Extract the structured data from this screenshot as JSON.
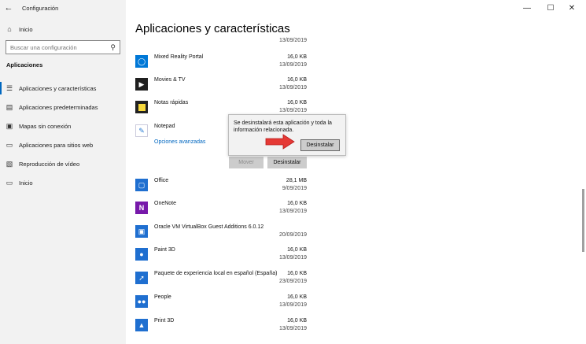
{
  "window": {
    "app_title": "Configuración",
    "back_icon": "back-arrow-icon",
    "minimize": "—",
    "maximize": "☐",
    "close": "✕"
  },
  "sidebar": {
    "home": "Inicio",
    "search_placeholder": "Buscar una configuración",
    "section": "Aplicaciones",
    "items": [
      {
        "label": "Aplicaciones y características",
        "icon": "list-icon"
      },
      {
        "label": "Aplicaciones predeterminadas",
        "icon": "default-apps-icon"
      },
      {
        "label": "Mapas sin conexión",
        "icon": "map-icon"
      },
      {
        "label": "Aplicaciones para sitios web",
        "icon": "web-apps-icon"
      },
      {
        "label": "Reproducción de vídeo",
        "icon": "video-icon"
      },
      {
        "label": "Inicio",
        "icon": "startup-icon"
      }
    ]
  },
  "main": {
    "title": "Aplicaciones y características",
    "top_date": "13/09/2019",
    "apps": [
      {
        "name": "Mixed Reality Portal",
        "size": "16,0 KB",
        "date": "13/09/2019",
        "color": "#0078d7",
        "icon": "mixed-reality-icon"
      },
      {
        "name": "Movies & TV",
        "size": "16,0 KB",
        "date": "13/09/2019",
        "color": "#1f1f1f",
        "icon": "movies-icon"
      },
      {
        "name": "Notas rápidas",
        "size": "16,0 KB",
        "date": "13/09/2019",
        "color": "#222222",
        "icon": "sticky-notes-icon"
      },
      {
        "name": "Notepad",
        "size": "",
        "date": "",
        "color": "#ffffff",
        "icon": "notepad-icon"
      },
      {
        "name": "Office",
        "size": "28,1 MB",
        "date": "9/09/2019",
        "color": "#1f6fd0",
        "icon": "office-icon"
      },
      {
        "name": "OneNote",
        "size": "16,0 KB",
        "date": "13/09/2019",
        "color": "#7719aa",
        "icon": "onenote-icon"
      },
      {
        "name": "Oracle VM VirtualBox Guest Additions 6.0.12",
        "size": "",
        "date": "20/09/2019",
        "color": "#1f6fd0",
        "icon": "virtualbox-icon"
      },
      {
        "name": "Paint 3D",
        "size": "16,0 KB",
        "date": "13/09/2019",
        "color": "#1f6fd0",
        "icon": "paint3d-icon"
      },
      {
        "name": "Paquete de experiencia local en español (España)",
        "size": "16,0 KB",
        "date": "23/09/2019",
        "color": "#1f6fd0",
        "icon": "language-pack-icon"
      },
      {
        "name": "People",
        "size": "16,0 KB",
        "date": "13/09/2019",
        "color": "#1f6fd0",
        "icon": "people-icon"
      },
      {
        "name": "Print 3D",
        "size": "16,0 KB",
        "date": "13/09/2019",
        "color": "#1f6fd0",
        "icon": "print3d-icon"
      }
    ],
    "advanced_link": "Opciones avanzadas",
    "move_button": "Mover",
    "uninstall_button": "Desinstalar"
  },
  "popup": {
    "message": "Se desinstalará esta aplicación y toda la información relacionada.",
    "confirm_button": "Desinstalar",
    "arrow_color": "#e53935"
  }
}
